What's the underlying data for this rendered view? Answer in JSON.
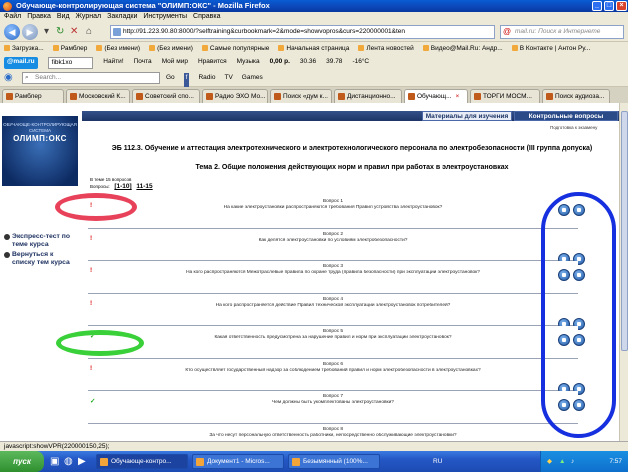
{
  "window": {
    "title": "Обучающе-контролирующая система \"ОЛИМП:ОКС\" - Mozilla Firefox"
  },
  "menu": [
    "Файл",
    "Правка",
    "Вид",
    "Журнал",
    "Закладки",
    "Инструменты",
    "Справка"
  ],
  "nav": {
    "url": "http://91.223.90.80:8000/?selftraining&curbookmark=2&mode=showvopros&curs=220000001&ten",
    "search_placeholder": "mail.ru: Поиск в Интернете"
  },
  "bookmarks": [
    "Загрузка...",
    "Рамблер",
    "(Без имени)",
    "(Без имени)",
    "Самые популярные",
    "Начальная страница",
    "Лента новостей",
    "Видео@Mail.Ru: Андр...",
    "В Контакте | Антон Ру..."
  ],
  "toolbar2": {
    "brand": "@mail.ru",
    "search_value": "fibk1xo",
    "find_label": "Найти!",
    "items": [
      "Почта",
      "Мой мир",
      "Нравится",
      "Музыка",
      "0,00 р.",
      "30.36",
      "39.78",
      "-16°C"
    ]
  },
  "toolbar3": {
    "search_placeholder": "Search...",
    "items": [
      "Go",
      "Radio",
      "TV",
      "Games"
    ]
  },
  "tabs": [
    {
      "label": "Рамблер",
      "active": false
    },
    {
      "label": "Московский К...",
      "active": false
    },
    {
      "label": "Советский спо...",
      "active": false
    },
    {
      "label": "Радио ЭХО Мо...",
      "active": false
    },
    {
      "label": "Поиск «дум к...",
      "active": false
    },
    {
      "label": "Дистанционно...",
      "active": false
    },
    {
      "label": "Обучающ...",
      "active": true
    },
    {
      "label": "ТОРГИ МОСМ...",
      "active": false
    },
    {
      "label": "Поиск аудиоза...",
      "active": false
    }
  ],
  "sidebar": {
    "logo_small": "ОБУЧАЮЩЕ-КОНТРОЛИРУЮЩАЯ СИСТЕМА",
    "logo_big": "ОЛИМП:ОКС",
    "links": [
      "Экспресс-тест по теме курса",
      "Вернуться к списку тем курса"
    ]
  },
  "main": {
    "tab_materials": "Материалы для изучения",
    "tab_control": "Контрольные вопросы",
    "prepared": "Подготовка к экзамену",
    "course_title": "ЭБ 112.3. Обучение и аттестация электротехнического и электротехнологического персонала по электробезопасности (III группа допуска)",
    "topic_title": "Тема 2. Общие положения действующих норм и правил при работах в электроустановках",
    "count_text": "В теме 15 вопросов",
    "pages_label": "Вопросы:",
    "pages": [
      "[1-10]",
      "11-15"
    ]
  },
  "questions": [
    {
      "num": "Вопрос 1",
      "text": "На какие электроустановки распространяются требования Правил устройства электроустановок?",
      "mark": "!"
    },
    {
      "num": "Вопрос 2",
      "text": "Как делятся электроустановки по условиям электробезопасности?",
      "mark": "!"
    },
    {
      "num": "Вопрос 3",
      "text": "На кого распространяются Межотраслевые правила по охране труда (правила безопасности) при эксплуатации электроустановок?",
      "mark": "!"
    },
    {
      "num": "Вопрос 4",
      "text": "На кого распространяется действие Правил технической эксплуатации электроустановок потребителей?",
      "mark": "!"
    },
    {
      "num": "Вопрос 5",
      "text": "Какая ответственность предусмотрена за нарушение правил и норм при эксплуатации электроустановок?",
      "mark": "✓"
    },
    {
      "num": "Вопрос 6",
      "text": "Кто осуществляет государственный надзор за соблюдением требований правил и норм электробезопасности в электроустановках?",
      "mark": "!"
    },
    {
      "num": "Вопрос 7",
      "text": "Чем должны быть укомплектованы электроустановки?",
      "mark": "✓"
    },
    {
      "num": "Вопрос 8",
      "text": "За что несут персональную ответственность работники, непосредственно обслуживающие электроустановки?",
      "mark": ""
    }
  ],
  "statusbar": {
    "text": "javascript:showVPR(220000150,25);"
  },
  "taskbar": {
    "start": "пуск",
    "tasks": [
      "Обучающе-контро...",
      "Документ1 - Micros...",
      "Безымянный (100%..."
    ],
    "lang": "RU",
    "clock": "7:57"
  },
  "colors": {
    "accent": "#1d3566",
    "error_mark": "#dd1111",
    "ok_mark": "#22aa22",
    "annotation_red": "#e8425a",
    "annotation_green": "#39d039",
    "annotation_blue": "#1630e0"
  }
}
